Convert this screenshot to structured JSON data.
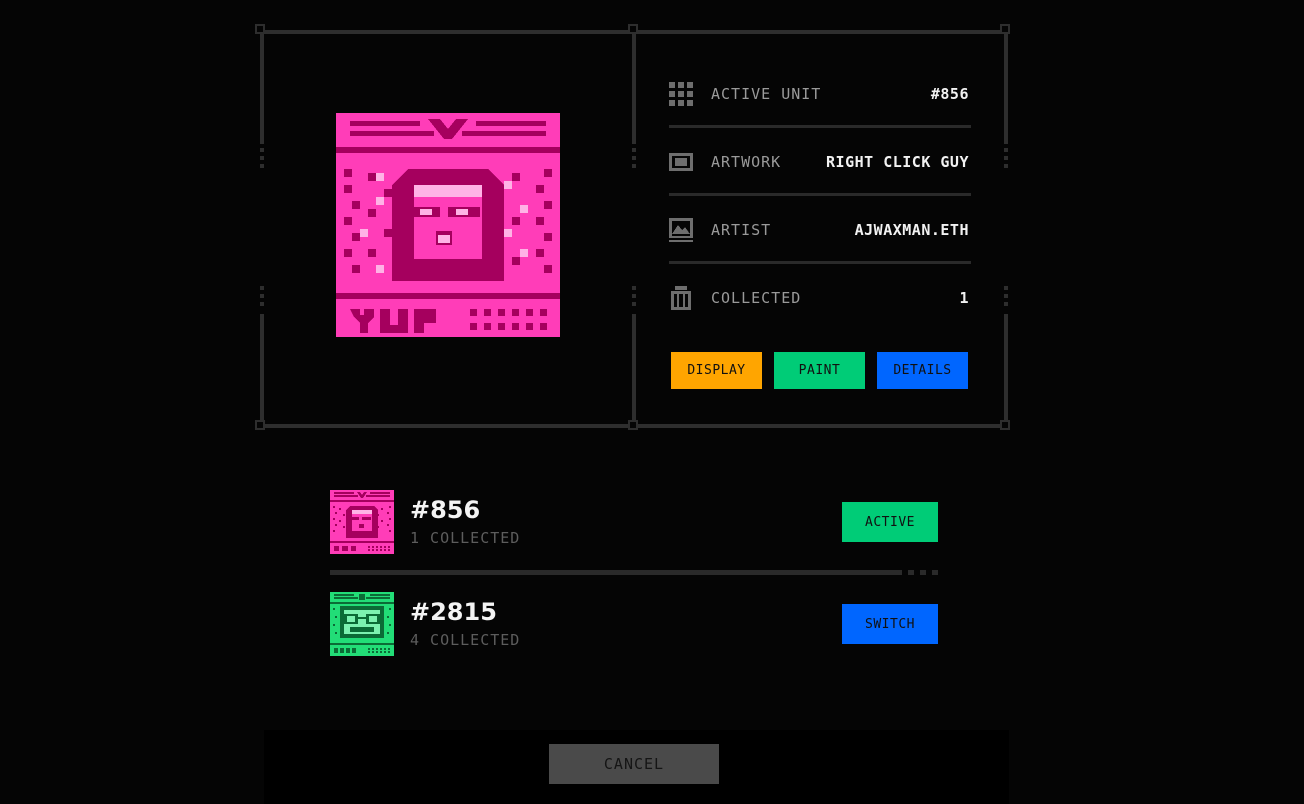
{
  "colors": {
    "background": "#050505",
    "frame": "#2e2e2e",
    "display": "#FFA500",
    "paint": "#00CC77",
    "details": "#0066FF",
    "active": "#00CC77",
    "switch": "#0066FF",
    "cancel": "#4A4A4A",
    "pink_art": "#FF3DB8",
    "green_art": "#22DD77"
  },
  "preview": {
    "image_icon": "yup-pixel-artwork"
  },
  "info": {
    "rows": [
      {
        "icon": "grid-icon",
        "label": "ACTIVE UNIT",
        "value": "#856"
      },
      {
        "icon": "frame-icon",
        "label": "ARTWORK",
        "value": "RIGHT CLICK GUY"
      },
      {
        "icon": "landscape-icon",
        "label": "ARTIST",
        "value": "AJWAXMAN.ETH"
      },
      {
        "icon": "collection-icon",
        "label": "COLLECTED",
        "value": "1"
      }
    ]
  },
  "actions": {
    "display": "DISPLAY",
    "paint": "PAINT",
    "details": "DETAILS"
  },
  "units": [
    {
      "id": "#856",
      "collected": "1 COLLECTED",
      "button": "ACTIVE",
      "thumb": "pink-yup-thumb"
    },
    {
      "id": "#2815",
      "collected": "4 COLLECTED",
      "button": "SWITCH",
      "thumb": "green-noun-thumb"
    }
  ],
  "footer": {
    "cancel": "CANCEL"
  }
}
